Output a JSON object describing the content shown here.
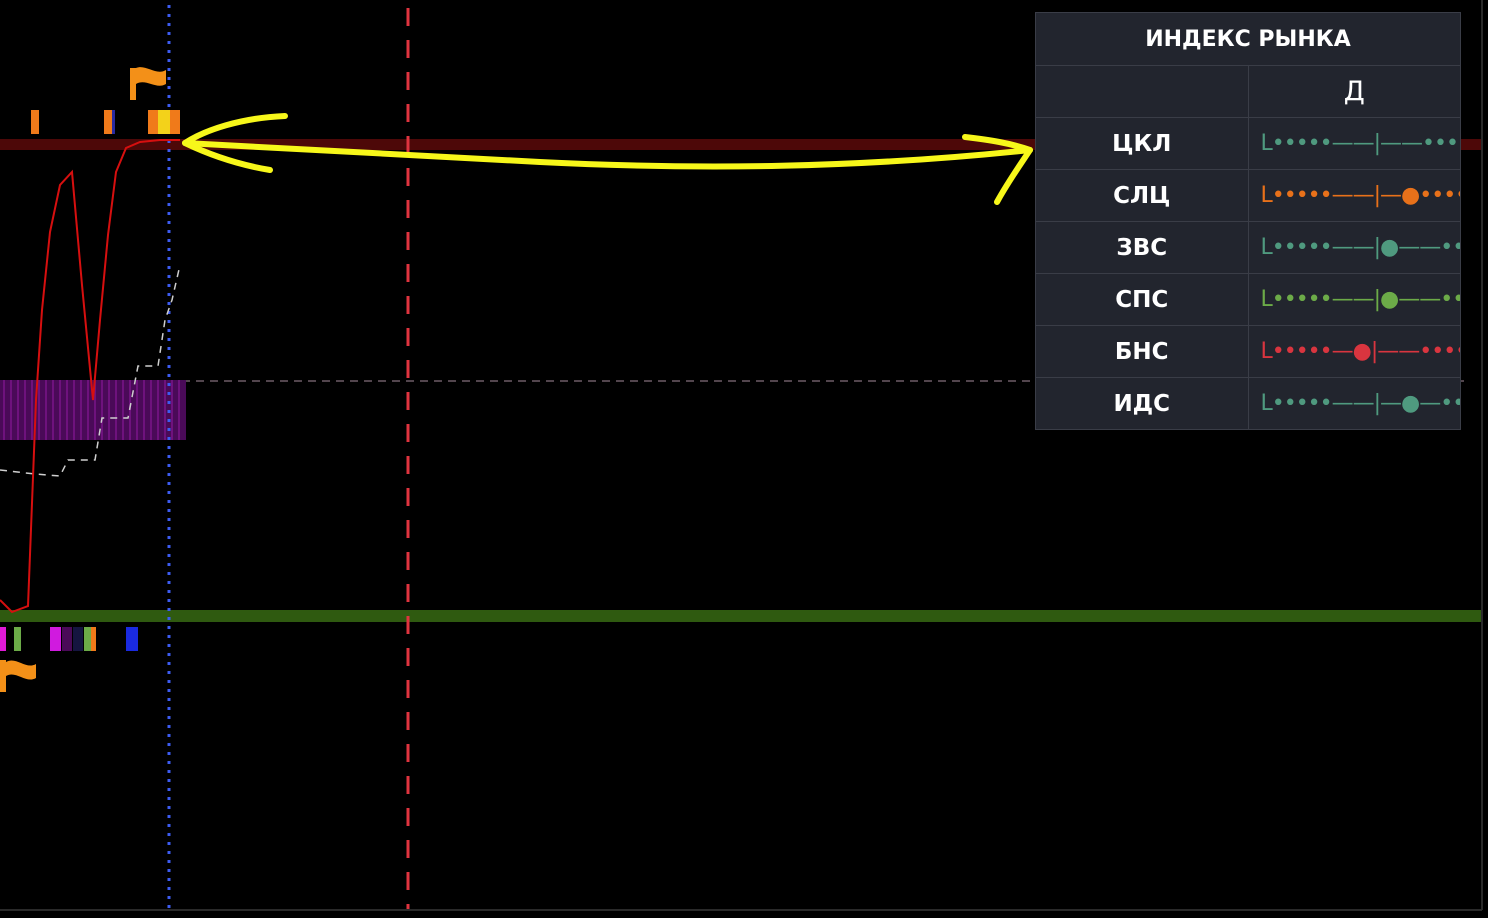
{
  "indicator_panel": {
    "title": "ИНДЕКС РЫНКА",
    "column_header": "Д",
    "rows": [
      {
        "label": "ЦКЛ",
        "scale": "L•••••——|——••••●H",
        "color": "#4f9a7f"
      },
      {
        "label": "СЛЦ",
        "scale": "L•••••——|—●•••••H",
        "color": "#e8711a"
      },
      {
        "label": "ЗВС",
        "scale": "L•••••——|●——•••••H",
        "color": "#4f9a7f"
      },
      {
        "label": "СПС",
        "scale": "L•••••——|●——•••••H",
        "color": "#6cab48"
      },
      {
        "label": "БНС",
        "scale": "L•••••—●|——•••••H",
        "color": "#d9353f"
      },
      {
        "label": "ИДС",
        "scale": "L•••••——|—●—•••••H",
        "color": "#4f9a7f"
      }
    ]
  },
  "colors": {
    "background": "#000000",
    "upper_band": "#4d0808",
    "lower_band": "#2f5a10",
    "signal_line": "#d60f0f",
    "annotation": "#f7f71a",
    "cursor_line": "#3d5cf2",
    "marker_line": "#e0343f",
    "histogram": "#5a0a66",
    "flag": "#f39018"
  },
  "icons": {
    "top_flag": "flag-icon",
    "bottom_flag": "flag-icon"
  }
}
